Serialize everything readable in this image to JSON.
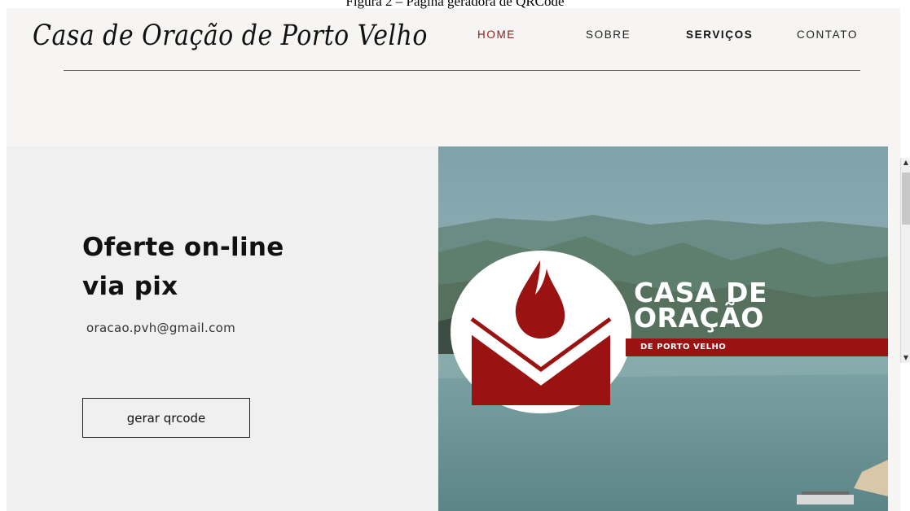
{
  "caption": "Figura 2 – Página geradora de QRCode",
  "header": {
    "logo_text": "Casa de Oração de Porto Velho",
    "nav": {
      "home": "HOME",
      "sobre": "SOBRE",
      "servicos": "SERVIÇOS",
      "contato": "CONTATO"
    }
  },
  "hero": {
    "title_line1": "Oferte on-line",
    "title_line2": "via pix",
    "email": "oracao.pvh@gmail.com",
    "button_label": "gerar qrcode"
  },
  "brand_image": {
    "title_line1": "CASA DE",
    "title_line2": "ORAÇÃO",
    "subtitle": "DE PORTO VELHO",
    "emblem_icon": "flame-over-open-book-icon",
    "brand_red": "#9b1212"
  },
  "scrollbar": {
    "up_icon": "arrow-up-icon",
    "down_icon": "arrow-down-icon"
  },
  "colors": {
    "active_nav": "#8b1a1a",
    "page_background": "#f6f5f3",
    "hero_background": "#f0f0f0"
  }
}
